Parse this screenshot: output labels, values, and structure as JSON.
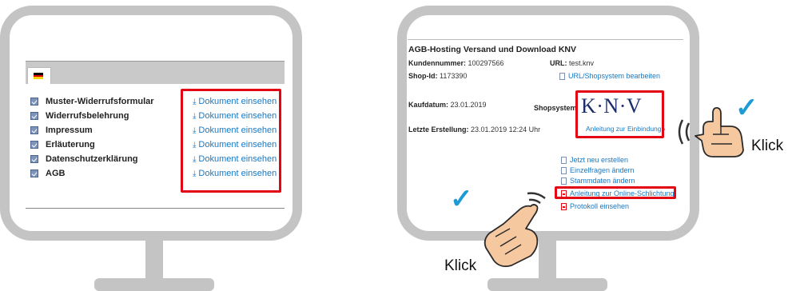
{
  "left_screen": {
    "tab_flag": "german-flag-icon",
    "items": [
      {
        "label": "Muster-Widerrufsformular",
        "action": "Dokument einsehen"
      },
      {
        "label": "Widerrufsbelehrung",
        "action": "Dokument einsehen"
      },
      {
        "label": "Impressum",
        "action": "Dokument einsehen"
      },
      {
        "label": "Erläuterung",
        "action": "Dokument einsehen"
      },
      {
        "label": "Datenschutzerklärung",
        "action": "Dokument einsehen"
      },
      {
        "label": "AGB",
        "action": "Dokument einsehen"
      }
    ]
  },
  "right_screen": {
    "title": "AGB-Hosting Versand und Download KNV",
    "kundennummer_label": "Kundennummer:",
    "kundennummer_value": "100297566",
    "url_label": "URL:",
    "url_value": "test.knv",
    "shop_id_label": "Shop-Id:",
    "shop_id_value": "1173390",
    "url_edit_link": "URL/Shopsystem bearbeiten",
    "kaufdatum_label": "Kaufdatum:",
    "kaufdatum_value": "23.01.2019",
    "shopsystem_label": "Shopsystem",
    "logo_text": "K·N·V",
    "logo_link": "Anleitung zur Einbindung ›",
    "letzte_label": "Letzte Erstellung:",
    "letzte_value": "23.01.2019 12:24 Uhr",
    "actions": [
      "Jetzt neu erstellen",
      "Einzelfragen ändern",
      "Stammdaten ändern",
      "Anleitung zur Online-Schlichtung",
      "Protokoll einsehen"
    ]
  },
  "annotations": {
    "klick_right": "Klick",
    "klick_bottom": "Klick",
    "check_color": "#1d9bd4",
    "highlight_color": "#e30613"
  }
}
